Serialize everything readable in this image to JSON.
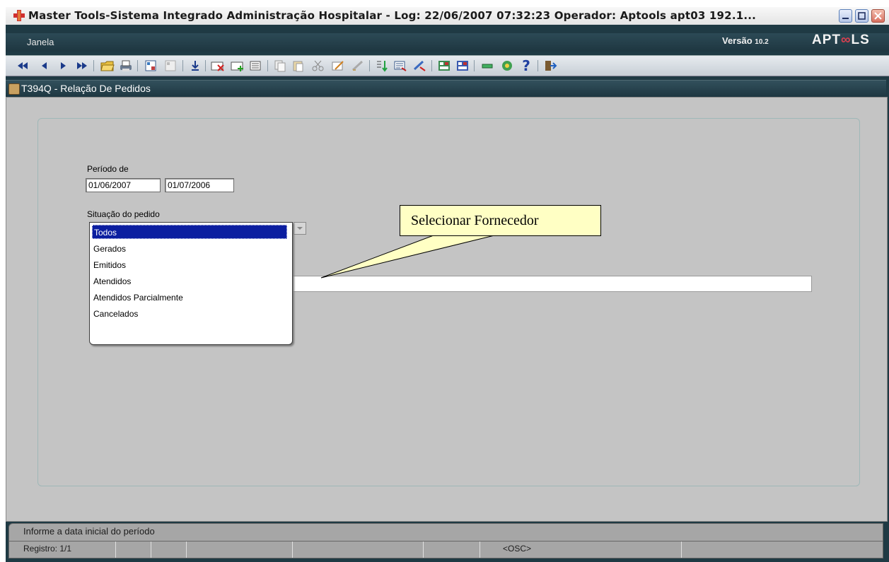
{
  "window": {
    "title": "Master Tools-Sistema Integrado Administração Hospitalar - Log: 22/06/2007 07:32:23 Operador: Aptools apt03 192.1..."
  },
  "menubar": {
    "janela": "Janela",
    "versao_label": "Versão",
    "versao_num": "10.2",
    "brand_prefix": "APT",
    "brand_suffix": "LS"
  },
  "form": {
    "title": "T394Q - Relação De Pedidos",
    "periodo_label": "Período de",
    "date_from": "01/06/2007",
    "date_to": "01/07/2006",
    "situacao_label": "Situação do pedido",
    "situacao_options": [
      "Todos",
      "Gerados",
      "Emitidos",
      "Atendidos",
      "Atendidos Parcialmente",
      "Cancelados"
    ]
  },
  "callout": {
    "text": "Selecionar Fornecedor"
  },
  "status": {
    "hint": "Informe a data inicial do período",
    "registro": "Registro: 1/1",
    "osc": "<OSC>"
  },
  "colors": {
    "chrome": "#1f3a44",
    "selection": "#0b1ea0",
    "callout_bg": "#ffffc4"
  }
}
